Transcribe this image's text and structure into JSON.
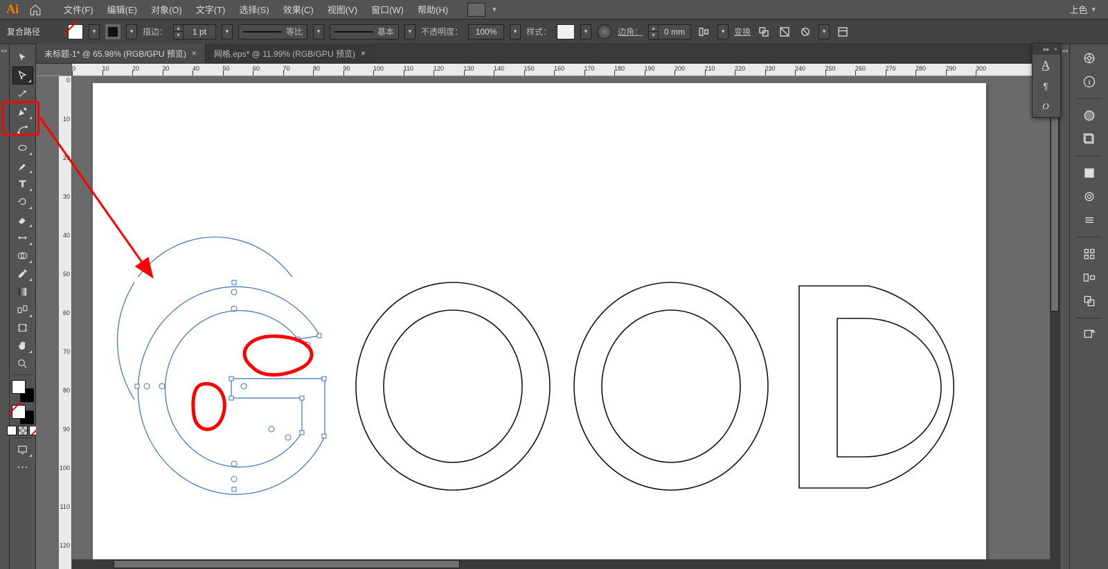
{
  "menubar": {
    "logo": "Ai",
    "items": [
      {
        "label": "文件",
        "u": "F",
        "full": "文件(F)"
      },
      {
        "label": "编辑",
        "u": "E",
        "full": "编辑(E)"
      },
      {
        "label": "对象",
        "u": "O",
        "full": "对象(O)"
      },
      {
        "label": "文字",
        "u": "T",
        "full": "文字(T)"
      },
      {
        "label": "选择",
        "u": "S",
        "full": "选择(S)"
      },
      {
        "label": "效果",
        "u": "C",
        "full": "效果(C)"
      },
      {
        "label": "视图",
        "u": "V",
        "full": "视图(V)"
      },
      {
        "label": "窗口",
        "u": "W",
        "full": "窗口(W)"
      },
      {
        "label": "帮助",
        "u": "H",
        "full": "帮助(H)"
      }
    ],
    "workspace": "上色"
  },
  "controlbar": {
    "selection_type": "复合路径",
    "stroke_label": "描边：",
    "stroke_weight": "1 pt",
    "profile_label": "等比",
    "brush_label": "基本",
    "opacity_label": "不透明度：",
    "opacity_value": "100%",
    "style_label": "样式：",
    "align_label": "边角：",
    "corner_value": "0 mm",
    "transform_label": "变换"
  },
  "tabs": [
    {
      "title": "未标题-1* @ 65.98% (RGB/GPU 预览)",
      "active": true
    },
    {
      "title": "网格.eps* @ 11.99% (RGB/GPU 预览)",
      "active": false
    }
  ],
  "ruler": {
    "h_start": 0,
    "h_end": 300,
    "h_step": 10,
    "v_values": [
      0,
      10,
      20,
      30,
      40,
      50,
      60,
      70,
      80,
      90,
      100,
      110,
      120
    ]
  },
  "tools": [
    {
      "name": "selection-tool",
      "icon": "arrow",
      "sel": false
    },
    {
      "name": "direct-selection-tool",
      "icon": "arrow-white",
      "sel": true
    },
    {
      "name": "magic-wand-tool",
      "icon": "wand"
    },
    {
      "name": "lasso-tool",
      "icon": "lasso"
    },
    {
      "name": "pen-tool",
      "icon": "pen"
    },
    {
      "name": "curvature-tool",
      "icon": "curve"
    },
    {
      "name": "ellipse-tool",
      "icon": "ellipse"
    },
    {
      "name": "paintbrush-tool",
      "icon": "brush"
    },
    {
      "name": "type-tool",
      "icon": "type"
    },
    {
      "name": "rotate-tool",
      "icon": "rotate"
    },
    {
      "name": "eraser-tool",
      "icon": "eraser"
    },
    {
      "name": "scale-tool",
      "icon": "scale"
    },
    {
      "name": "width-tool",
      "icon": "width"
    },
    {
      "name": "shape-builder-tool",
      "icon": "shapebuilder"
    },
    {
      "name": "eyedropper-tool",
      "icon": "eyedropper"
    },
    {
      "name": "blend-tool",
      "icon": "blend"
    },
    {
      "name": "symbol-sprayer-tool",
      "icon": "spray"
    },
    {
      "name": "artboard-tool",
      "icon": "artboard"
    },
    {
      "name": "hand-tool",
      "icon": "hand"
    },
    {
      "name": "zoom-tool",
      "icon": "zoom"
    }
  ],
  "artwork": {
    "text": "GOOD",
    "selected_letter": "G"
  },
  "rightpanel_icons": [
    "character",
    "paragraph",
    "opentype"
  ],
  "rightdock_icons": [
    "color-wheel",
    "info",
    "appearance",
    "gradient",
    "layers",
    "swatches",
    "artboards",
    "stroke",
    "brushes",
    "symbols",
    "transparency",
    "pathfinder",
    "export"
  ]
}
